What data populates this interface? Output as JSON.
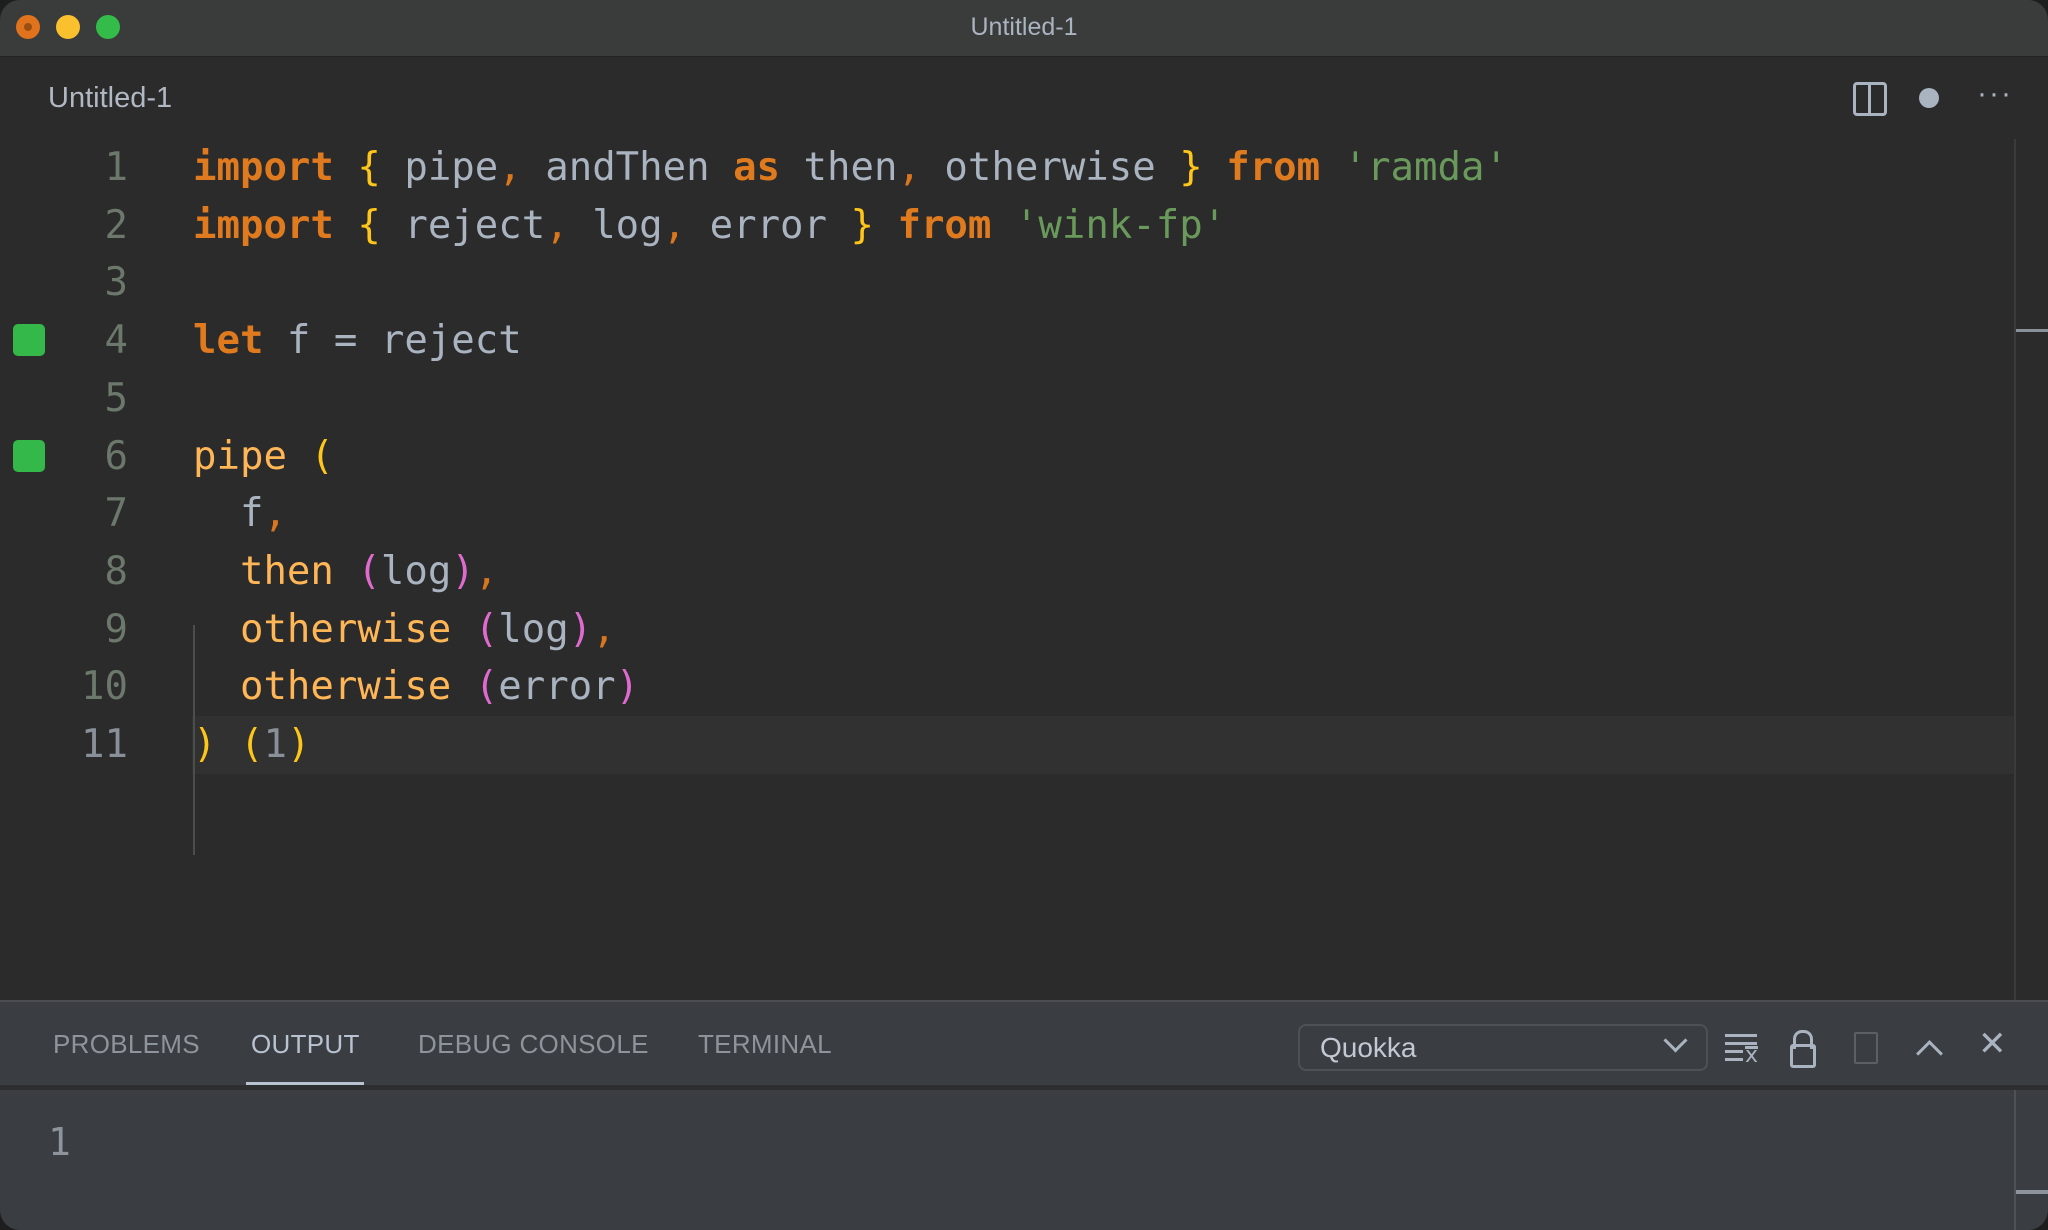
{
  "window": {
    "title": "Untitled-1",
    "traffic_lights": [
      "close",
      "minimize",
      "maximize"
    ]
  },
  "editor_tab": {
    "title": "Untitled-1",
    "actions": [
      {
        "icon": "split-editor-icon"
      },
      {
        "icon": "unsaved-dot-icon"
      },
      {
        "icon": "more-actions-icon",
        "glyph": "···"
      }
    ]
  },
  "editor": {
    "current_line": 11,
    "lines": [
      {
        "number": "1",
        "marker": false,
        "tokens": [
          {
            "t": "import",
            "c": "kw"
          },
          {
            "t": " ",
            "c": "id"
          },
          {
            "t": "{",
            "c": "brace"
          },
          {
            "t": " pipe",
            "c": "id"
          },
          {
            "t": ",",
            "c": "punct"
          },
          {
            "t": " andThen ",
            "c": "id"
          },
          {
            "t": "as",
            "c": "kw"
          },
          {
            "t": " then",
            "c": "id"
          },
          {
            "t": ",",
            "c": "punct"
          },
          {
            "t": " otherwise ",
            "c": "id"
          },
          {
            "t": "}",
            "c": "brace"
          },
          {
            "t": " ",
            "c": "id"
          },
          {
            "t": "from",
            "c": "kw"
          },
          {
            "t": " ",
            "c": "id"
          },
          {
            "t": "'ramda'",
            "c": "str"
          }
        ]
      },
      {
        "number": "2",
        "marker": false,
        "tokens": [
          {
            "t": "import",
            "c": "kw"
          },
          {
            "t": " ",
            "c": "id"
          },
          {
            "t": "{",
            "c": "brace"
          },
          {
            "t": " reject",
            "c": "id"
          },
          {
            "t": ",",
            "c": "punct"
          },
          {
            "t": " log",
            "c": "id"
          },
          {
            "t": ",",
            "c": "punct"
          },
          {
            "t": " error ",
            "c": "id"
          },
          {
            "t": "}",
            "c": "brace"
          },
          {
            "t": " ",
            "c": "id"
          },
          {
            "t": "from",
            "c": "kw"
          },
          {
            "t": " ",
            "c": "id"
          },
          {
            "t": "'wink-fp'",
            "c": "str"
          }
        ]
      },
      {
        "number": "3",
        "marker": false,
        "tokens": []
      },
      {
        "number": "4",
        "marker": true,
        "tokens": [
          {
            "t": "let",
            "c": "kw"
          },
          {
            "t": " f = reject",
            "c": "id"
          }
        ]
      },
      {
        "number": "5",
        "marker": false,
        "tokens": []
      },
      {
        "number": "6",
        "marker": true,
        "tokens": [
          {
            "t": "pipe",
            "c": "fn"
          },
          {
            "t": " ",
            "c": "id"
          },
          {
            "t": "(",
            "c": "brace"
          }
        ]
      },
      {
        "number": "7",
        "marker": false,
        "tokens": [
          {
            "t": "  f",
            "c": "id"
          },
          {
            "t": ",",
            "c": "punct"
          }
        ]
      },
      {
        "number": "8",
        "marker": false,
        "tokens": [
          {
            "t": "  then",
            "c": "fn"
          },
          {
            "t": " ",
            "c": "id"
          },
          {
            "t": "(",
            "c": "paren2"
          },
          {
            "t": "log",
            "c": "id"
          },
          {
            "t": ")",
            "c": "paren2"
          },
          {
            "t": ",",
            "c": "punct"
          }
        ]
      },
      {
        "number": "9",
        "marker": false,
        "tokens": [
          {
            "t": "  otherwise",
            "c": "fn"
          },
          {
            "t": " ",
            "c": "id"
          },
          {
            "t": "(",
            "c": "paren2"
          },
          {
            "t": "log",
            "c": "id"
          },
          {
            "t": ")",
            "c": "paren2"
          },
          {
            "t": ",",
            "c": "punct"
          }
        ]
      },
      {
        "number": "10",
        "marker": false,
        "tokens": [
          {
            "t": "  otherwise",
            "c": "fn"
          },
          {
            "t": " ",
            "c": "id"
          },
          {
            "t": "(",
            "c": "paren2"
          },
          {
            "t": "error",
            "c": "id"
          },
          {
            "t": ")",
            "c": "paren2"
          }
        ]
      },
      {
        "number": "11",
        "marker": false,
        "tokens": [
          {
            "t": ")",
            "c": "brace"
          },
          {
            "t": " ",
            "c": "id"
          },
          {
            "t": "(",
            "c": "brace"
          },
          {
            "t": "1",
            "c": "num"
          },
          {
            "t": ")",
            "c": "brace"
          }
        ]
      }
    ],
    "colors": {
      "keyword": "#e07a1f",
      "brace": "#ffc61a",
      "paren_nested": "#e06bd0",
      "string": "#6a9a5b",
      "function": "#ffb657",
      "identifier": "#aab3c0",
      "gutter_marker": "#35b84a"
    }
  },
  "panel": {
    "tabs": [
      {
        "label": "PROBLEMS",
        "active": false
      },
      {
        "label": "OUTPUT",
        "active": true
      },
      {
        "label": "DEBUG CONSOLE",
        "active": false
      },
      {
        "label": "TERMINAL",
        "active": false
      }
    ],
    "output_channel": "Quokka",
    "actions": [
      {
        "icon": "clear-output-icon"
      },
      {
        "icon": "lock-scroll-icon"
      },
      {
        "icon": "open-log-file-icon",
        "enabled": false
      },
      {
        "icon": "maximize-panel-icon"
      },
      {
        "icon": "close-panel-icon",
        "glyph": "✕"
      }
    ],
    "output_lines": [
      "1"
    ]
  }
}
